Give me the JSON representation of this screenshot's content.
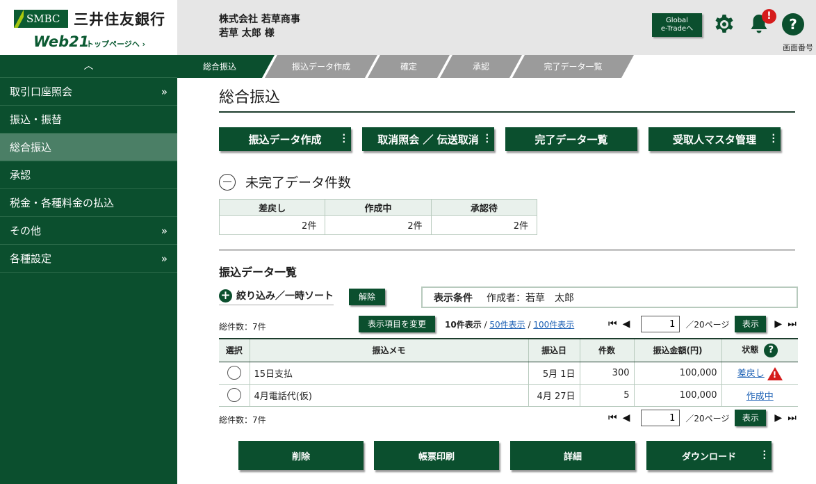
{
  "header": {
    "smbc_logo": "SMBC",
    "bank_name": "三井住友銀行",
    "product": "Web21",
    "top_link": "トップページへ ›",
    "company": "株式会社 若草商事",
    "user": "若草 太郎 様",
    "global_btn_line1": "Global",
    "global_btn_line2": "e-Tradeへ",
    "notification_badge": "!",
    "help": "?",
    "screen_no": "画面番号"
  },
  "sidebar": {
    "toggle": "︿",
    "items": [
      {
        "label": "取引口座照会",
        "arrow": "»"
      },
      {
        "label": "振込・振替",
        "arrow": ""
      },
      {
        "label": "総合振込",
        "arrow": ""
      },
      {
        "label": "承認",
        "arrow": ""
      },
      {
        "label": "税金・各種料金の払込",
        "arrow": ""
      },
      {
        "label": "その他",
        "arrow": "»"
      },
      {
        "label": "各種設定",
        "arrow": "»"
      }
    ]
  },
  "steps": [
    "総合振込",
    "振込データ作成",
    "確定",
    "承認",
    "完了データ一覧"
  ],
  "main": {
    "title": "総合振込",
    "buttons": [
      "振込データ作成",
      "取消照会 ／ 伝送取消",
      "完了データ一覧",
      "受取人マスタ管理"
    ],
    "incomplete_title": "未完了データ件数",
    "counts": {
      "headers": [
        "差戻し",
        "作成中",
        "承認待"
      ],
      "values": [
        "2件",
        "2件",
        "2件"
      ]
    },
    "list_title": "振込データ一覧",
    "filter_link": "絞り込み／一時ソート",
    "clear_btn": "解除",
    "cond_label": "表示条件",
    "cond_value": "作成者：若草　太郎",
    "total": "総件数：7件",
    "change_cols": "表示項目を変更",
    "per_page": {
      "current": "10件表示",
      "sep1": " / ",
      "opt50": "50件表示",
      "sep2": " / ",
      "opt100": "100件表示"
    },
    "pager": {
      "page": "1",
      "total": "／20ページ",
      "show": "表示"
    },
    "table": {
      "headers": [
        "選択",
        "振込メモ",
        "振込日",
        "件数",
        "振込金額(円)",
        "状態"
      ],
      "rows": [
        {
          "memo": "15日支払",
          "date": "5月 1日",
          "count": "300",
          "amount": "100,000",
          "status": "差戻し"
        },
        {
          "memo": "4月電話代(仮)",
          "date": "4月 27日",
          "count": "5",
          "amount": "100,000",
          "status": "作成中"
        }
      ]
    },
    "bottom_buttons": [
      "削除",
      "帳票印刷",
      "詳細",
      "ダウンロード"
    ]
  },
  "colors": {
    "brand": "#0b4f2e",
    "active_sidebar": "#4b7f66",
    "warning": "#d51c1c"
  }
}
